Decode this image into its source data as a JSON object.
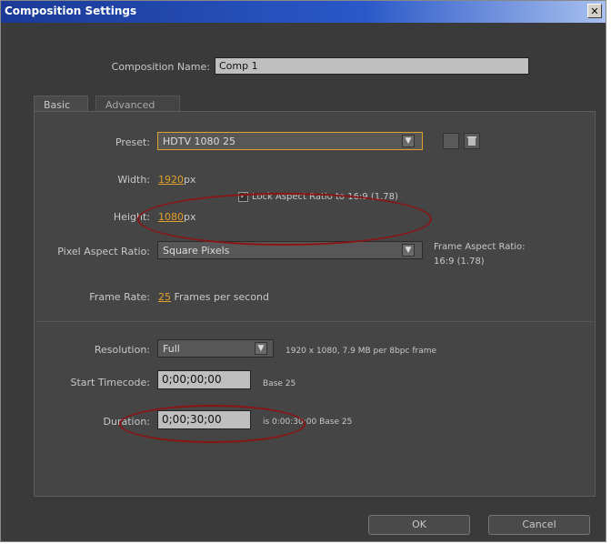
{
  "window": {
    "title": "Composition Settings",
    "close_glyph": "✕"
  },
  "comp_name": {
    "label": "Composition Name:",
    "value": "Comp 1"
  },
  "tabs": [
    {
      "label": "Basic"
    },
    {
      "label": "Advanced"
    }
  ],
  "preset": {
    "label": "Preset:",
    "value": "HDTV 1080 25",
    "arrow": "▼"
  },
  "width": {
    "label": "Width:",
    "value": "1920",
    "unit": "px"
  },
  "lock": {
    "label": "Lock Aspect Ratio to 16:9 (1.78)",
    "checked": true,
    "check_glyph": "✓"
  },
  "height": {
    "label": "Height:",
    "value": "1080",
    "unit": "px"
  },
  "par": {
    "label": "Pixel Aspect Ratio:",
    "value": "Square Pixels",
    "arrow": "▼"
  },
  "frame_aspect": {
    "line1": "Frame Aspect Ratio:",
    "line2": "16:9 (1.78)"
  },
  "frame_rate": {
    "label": "Frame Rate:",
    "value": "25",
    "suffix": "Frames per second"
  },
  "resolution": {
    "label": "Resolution:",
    "value": "Full",
    "arrow": "▼",
    "info": "1920 x 1080, 7.9 MB per 8bpc frame"
  },
  "start_tc": {
    "label": "Start Timecode:",
    "value": "0;00;00;00",
    "info": "Base 25"
  },
  "duration": {
    "label": "Duration:",
    "value": "0;00;30;00",
    "info": "is 0:00:30:00  Base 25"
  },
  "buttons": {
    "ok": "OK",
    "cancel": "Cancel"
  },
  "colors": {
    "accent": "#e1a02a",
    "annotation": "#8a1515",
    "titlebar": "#1a3a96"
  }
}
